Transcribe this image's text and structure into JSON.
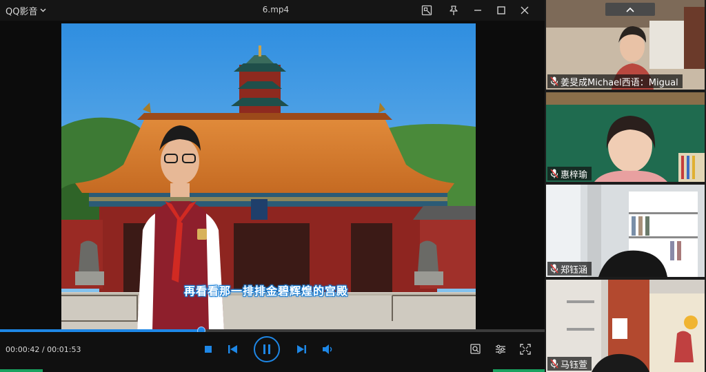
{
  "player": {
    "brand": "QQ影音",
    "filename": "6.mp4",
    "subtitle": "再看看那一排排金碧辉煌的宫殿",
    "time_display": "00:00:42 / 00:01:53",
    "progress_fraction": 0.37,
    "titlebar_icons": [
      "screenshot-icon",
      "pin-icon",
      "minimize-icon",
      "maximize-icon",
      "close-icon"
    ],
    "control_icons": [
      "stop-icon",
      "previous-icon",
      "pause-icon",
      "next-icon",
      "volume-icon"
    ],
    "right_icons": [
      "search-icon",
      "settings-icon",
      "fullscreen-icon"
    ],
    "accent": "#1e87e6"
  },
  "meeting": {
    "participants": [
      {
        "name": "姜旻成Michael西语：Migual",
        "muted": true
      },
      {
        "name": "惠梓瑜",
        "muted": true
      },
      {
        "name": "郑钰涵",
        "muted": true
      },
      {
        "name": "马钰萱",
        "muted": true
      }
    ]
  }
}
